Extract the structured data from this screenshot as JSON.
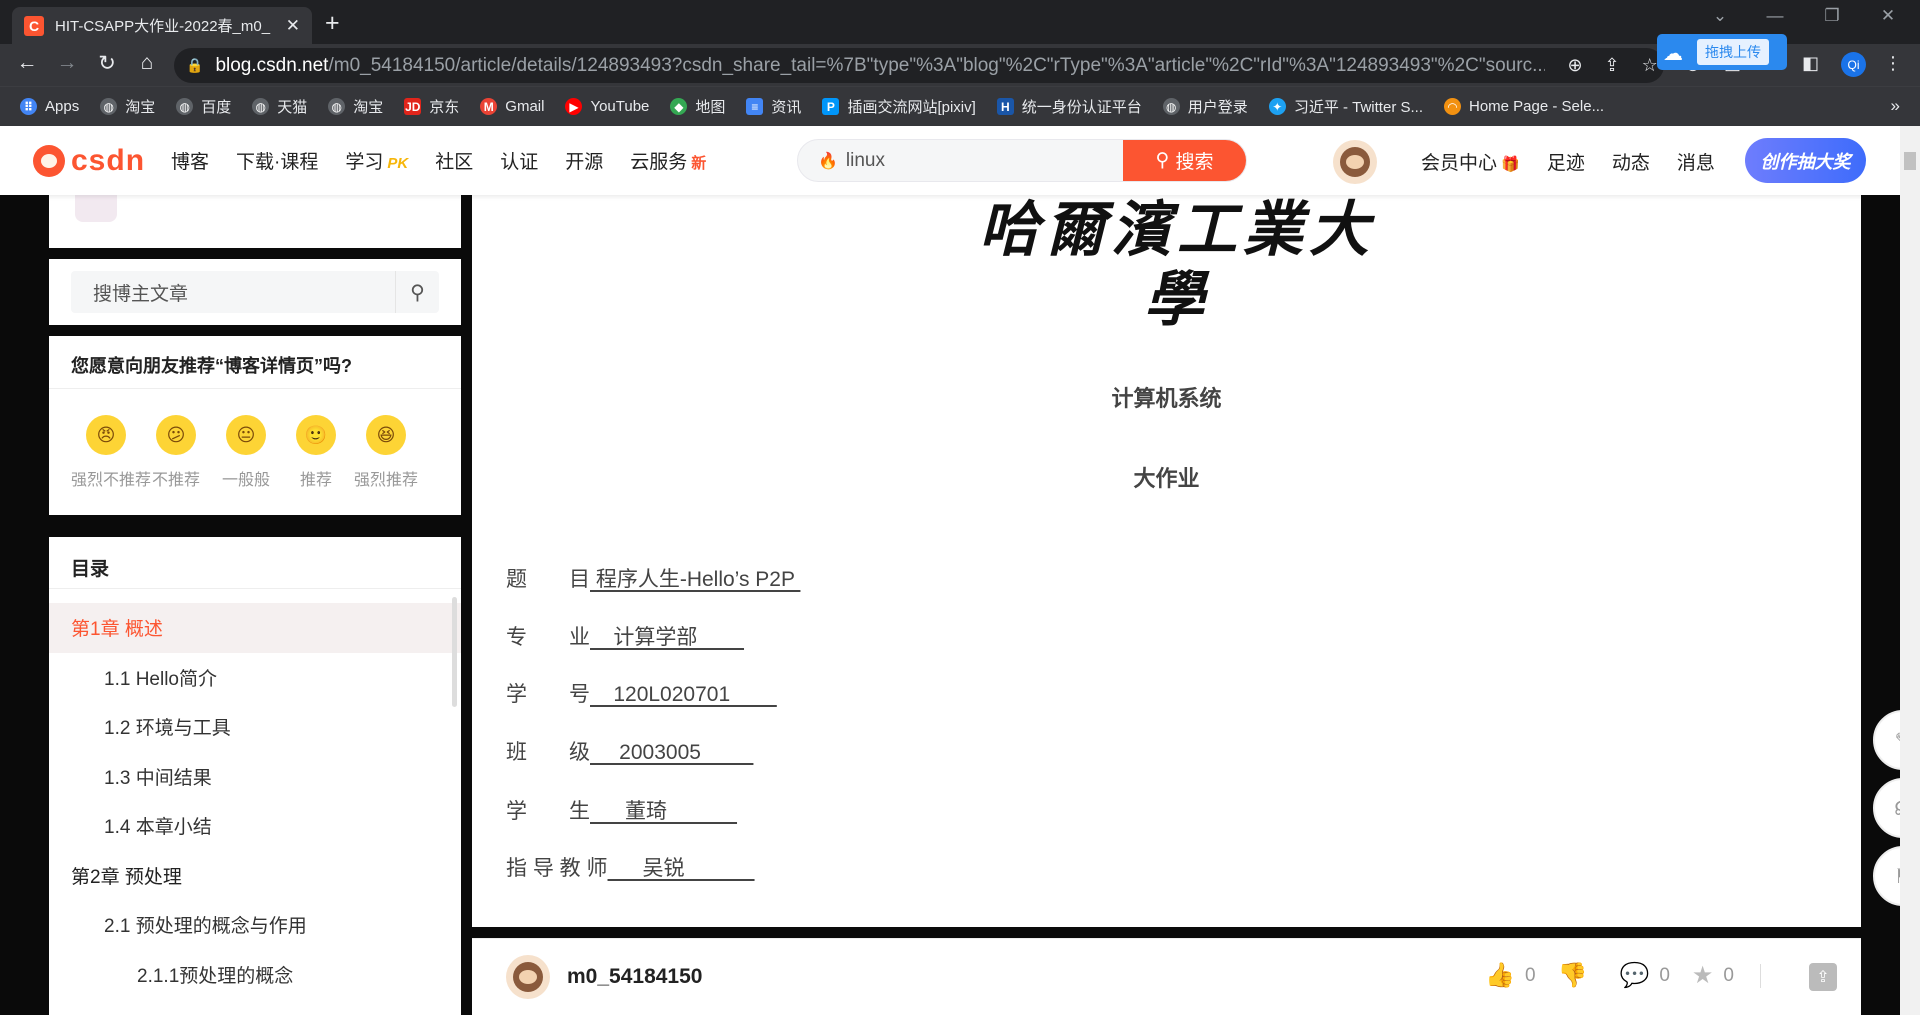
{
  "browser": {
    "tab_title": "HIT-CSAPP大作业-2022春_m0_",
    "tab_favicon": "C",
    "url_host": "blog.csdn.net",
    "url_path": "/m0_54184150/article/details/124893493?csdn_share_tail=%7B\"type\"%3A\"blog\"%2C\"rType\"%3A\"article\"%2C\"rId\"%3A\"124893493\"%2C\"sourc...",
    "baidu_upload_label": "拖拽上传",
    "profile_initials": "Qi",
    "bookmarks": [
      {
        "label": "Apps",
        "icon": "apps-grid-icon",
        "color": "#4285f4"
      },
      {
        "label": "淘宝",
        "icon": "globe-icon",
        "color": "#5f6368"
      },
      {
        "label": "百度",
        "icon": "globe-icon",
        "color": "#5f6368"
      },
      {
        "label": "天猫",
        "icon": "globe-icon",
        "color": "#5f6368"
      },
      {
        "label": "淘宝",
        "icon": "globe-icon",
        "color": "#5f6368"
      },
      {
        "label": "京东",
        "icon": "jd-icon",
        "color": "#e1251b"
      },
      {
        "label": "Gmail",
        "icon": "gmail-icon",
        "color": "#ea4335"
      },
      {
        "label": "YouTube",
        "icon": "youtube-icon",
        "color": "#ff0000"
      },
      {
        "label": "地图",
        "icon": "maps-icon",
        "color": "#34a853"
      },
      {
        "label": "资讯",
        "icon": "news-icon",
        "color": "#4285f4"
      },
      {
        "label": "插画交流网站[pixiv]",
        "icon": "pixiv-icon",
        "color": "#0096fa"
      },
      {
        "label": "统一身份认证平台",
        "icon": "hit-icon",
        "color": "#1a56a8"
      },
      {
        "label": "用户登录",
        "icon": "globe-icon",
        "color": "#5f6368"
      },
      {
        "label": "习近平 - Twitter S...",
        "icon": "twitter-icon",
        "color": "#1da1f2"
      },
      {
        "label": "Home Page - Sele...",
        "icon": "selenium-icon",
        "color": "#f29111"
      }
    ]
  },
  "csdn": {
    "logo": "CSDN",
    "nav": [
      {
        "label": "博客",
        "tag": ""
      },
      {
        "label": "下载·课程",
        "tag": ""
      },
      {
        "label": "学习",
        "tag": "PK"
      },
      {
        "label": "社区",
        "tag": ""
      },
      {
        "label": "认证",
        "tag": ""
      },
      {
        "label": "开源",
        "tag": ""
      },
      {
        "label": "云服务",
        "tag": "新"
      }
    ],
    "search_value": "linux",
    "search_button": "搜索",
    "header_right": [
      "会员中心",
      "足迹",
      "动态",
      "消息"
    ],
    "create_button": "创作抽大奖",
    "accent": "#fc5531"
  },
  "sidebar": {
    "search_placeholder": "搜博主文章",
    "recommend_title": "您愿意向朋友推荐“博客详情页”吗?",
    "recommend_options": [
      {
        "label": "强烈不推荐",
        "face": "😠"
      },
      {
        "label": "不推荐",
        "face": "😕"
      },
      {
        "label": "一般般",
        "face": "😐"
      },
      {
        "label": "推荐",
        "face": "🙂"
      },
      {
        "label": "强烈推荐",
        "face": "😆"
      }
    ],
    "toc_title": "目录",
    "toc": [
      {
        "label": "第1章 概述",
        "level": 1,
        "active": true
      },
      {
        "label": "1.1 Hello简介",
        "level": 2,
        "active": false
      },
      {
        "label": "1.2 环境与工具",
        "level": 2,
        "active": false
      },
      {
        "label": "1.3 中间结果",
        "level": 2,
        "active": false
      },
      {
        "label": "1.4 本章小结",
        "level": 2,
        "active": false
      },
      {
        "label": "第2章 预处理",
        "level": 1,
        "active": false
      },
      {
        "label": "2.1 预处理的概念与作用",
        "level": 2,
        "active": false
      },
      {
        "label": "2.1.1预处理的概念",
        "level": 3,
        "active": false
      }
    ]
  },
  "article": {
    "school": "哈爾濱工業大學",
    "course": "计算机系统",
    "assignment": "大作业",
    "fields": [
      {
        "label": "题　　目",
        "value": " 程序人生-Hello’s P2P "
      },
      {
        "label": "专　　业",
        "value": "    计算学部        "
      },
      {
        "label": "学　　号",
        "value": "    120L020701        "
      },
      {
        "label": "班　　级",
        "value": "     2003005         "
      },
      {
        "label": "学　　生",
        "value": "      董琦            "
      },
      {
        "label": "指 导 教 师",
        "value": "      吴锐            "
      }
    ]
  },
  "bottom_bar": {
    "author": "m0_54184150",
    "likes": "0",
    "comments": "0",
    "favorites": "0"
  }
}
